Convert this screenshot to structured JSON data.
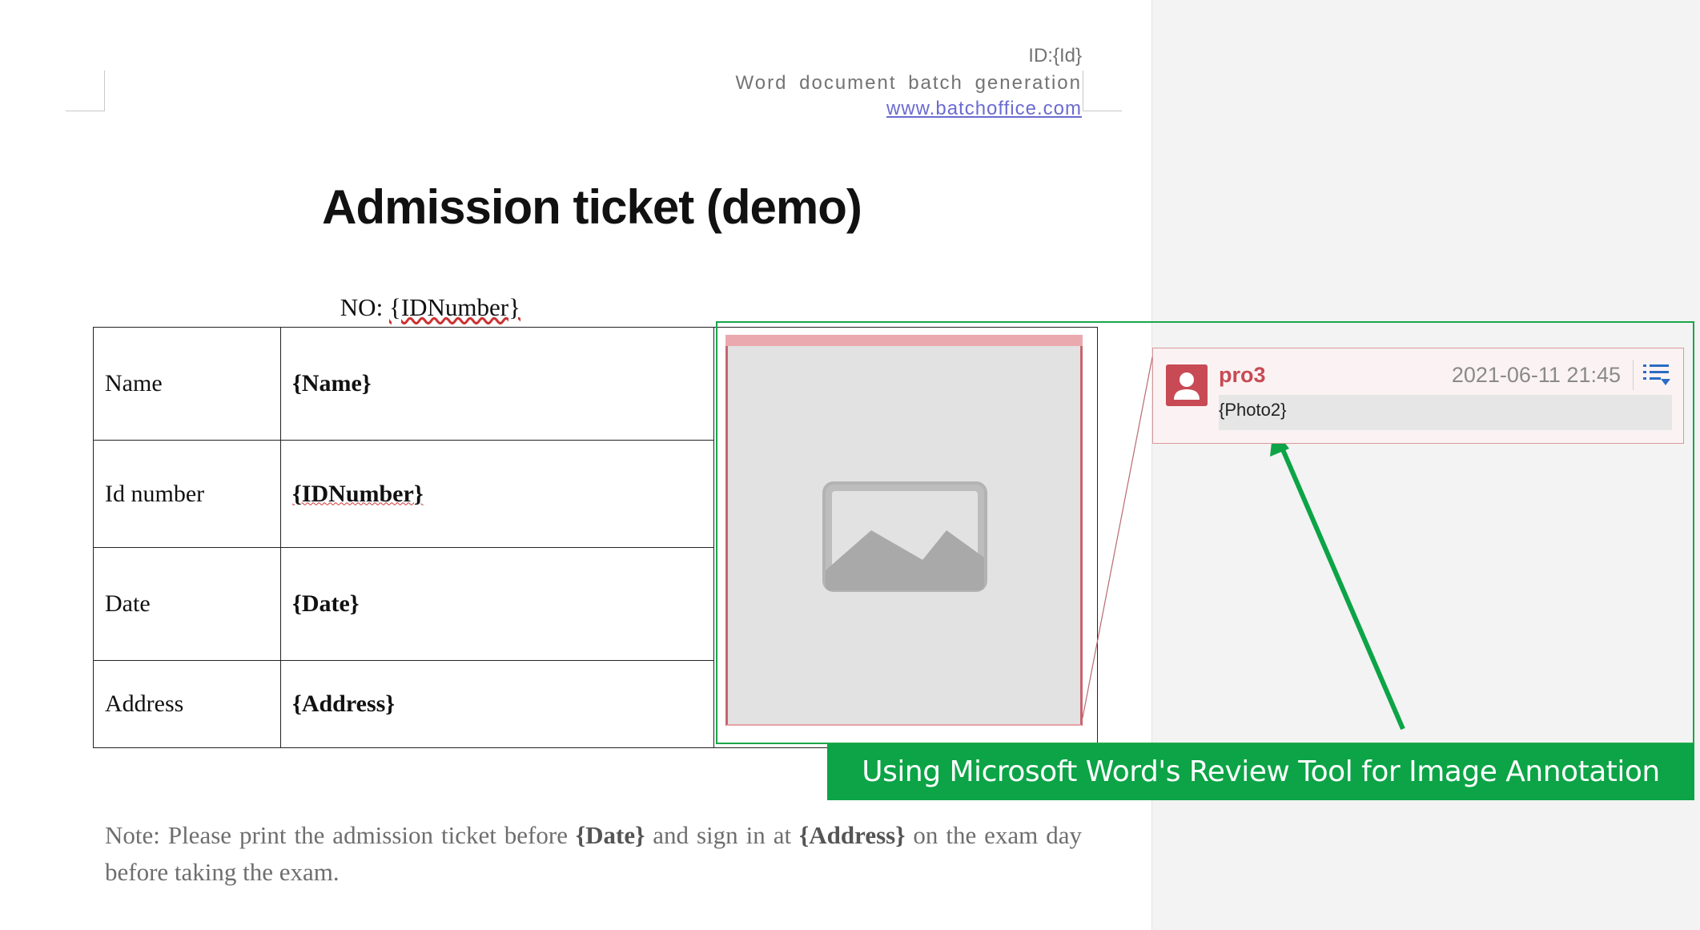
{
  "header": {
    "id_line": "ID:{Id}",
    "subtitle": "Word document batch generation",
    "link": "www.batchoffice.com"
  },
  "document": {
    "title": "Admission ticket (demo)",
    "ticket_no_prefix": "NO: ",
    "ticket_no_value": "{IDNumber}",
    "rows": [
      {
        "label": "Name",
        "value": "{Name}"
      },
      {
        "label": "Id number",
        "value": "{IDNumber}"
      },
      {
        "label": "Date",
        "value": "{Date}"
      },
      {
        "label": "Address",
        "value": "{Address}"
      }
    ],
    "photo_icon": "image-placeholder-icon",
    "note": {
      "part1": "Note: Please print the admission ticket before ",
      "date": "{Date}",
      "part2": " and sign in at ",
      "address": "{Address}",
      "part3": " on the exam day before taking the exam."
    }
  },
  "comment": {
    "author": "pro3",
    "timestamp": "2021-06-11 21:45",
    "text": "{Photo2}",
    "avatar_icon": "user-avatar-icon",
    "menu_icon": "comment-menu-icon"
  },
  "annotation": {
    "banner": "Using Microsoft Word's Review Tool for Image Annotation",
    "arrow_color": "#0ca446"
  }
}
